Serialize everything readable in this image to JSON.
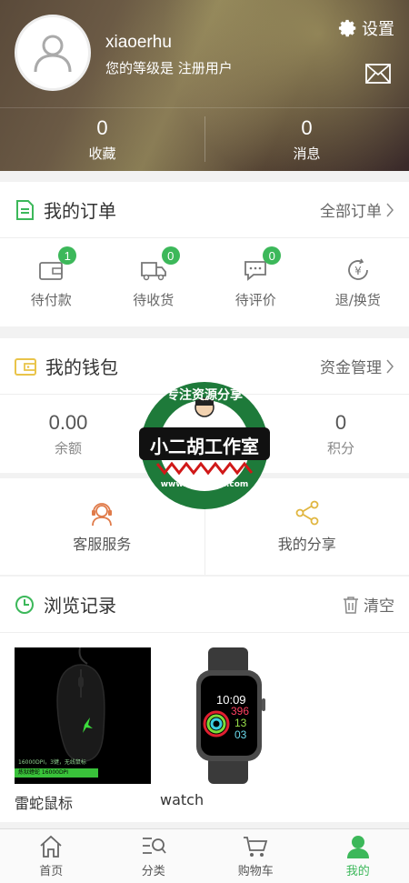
{
  "header": {
    "username": "xiaoerhu",
    "level_text": "您的等级是 注册用户",
    "settings_label": "设置",
    "stats": [
      {
        "value": "0",
        "label": "收藏"
      },
      {
        "value": "0",
        "label": "消息"
      }
    ]
  },
  "orders": {
    "title": "我的订单",
    "more": "全部订单",
    "items": [
      {
        "label": "待付款",
        "badge": "1",
        "icon": "wallet-icon"
      },
      {
        "label": "待收货",
        "badge": "0",
        "icon": "truck-icon"
      },
      {
        "label": "待评价",
        "badge": "0",
        "icon": "comment-icon"
      },
      {
        "label": "退/换货",
        "badge": "",
        "icon": "yuan-return-icon"
      }
    ]
  },
  "wallet": {
    "title": "我的钱包",
    "more": "资金管理",
    "items": [
      {
        "value": "0.00",
        "label": "余额"
      },
      {
        "value": "0",
        "label": "积分"
      }
    ]
  },
  "services": [
    {
      "label": "客服服务",
      "icon": "headset-icon",
      "color": "#e07b4a"
    },
    {
      "label": "我的分享",
      "icon": "share-icon",
      "color": "#e0b640"
    }
  ],
  "history": {
    "title": "浏览记录",
    "clear": "清空",
    "items": [
      {
        "name": "雷蛇鼠标",
        "img_text_1": "16000DPI，3键，无线鼠标",
        "img_text_2": "炼狱蝰蛇 16000DPI"
      },
      {
        "name": "watch",
        "time": "10:09",
        "nums": [
          "396",
          "13",
          "03"
        ]
      }
    ]
  },
  "watermark": {
    "top_text": "专注资源分享",
    "main_text": "小二胡工作室",
    "bottom_text": "www.xiaoerhu.com"
  },
  "tabbar": [
    {
      "label": "首页",
      "icon": "home-icon"
    },
    {
      "label": "分类",
      "icon": "category-search-icon"
    },
    {
      "label": "购物车",
      "icon": "cart-icon"
    },
    {
      "label": "我的",
      "icon": "user-icon",
      "active": true
    }
  ],
  "colors": {
    "accent": "#3cb85a",
    "wallet_icon": "#e9c44a"
  }
}
